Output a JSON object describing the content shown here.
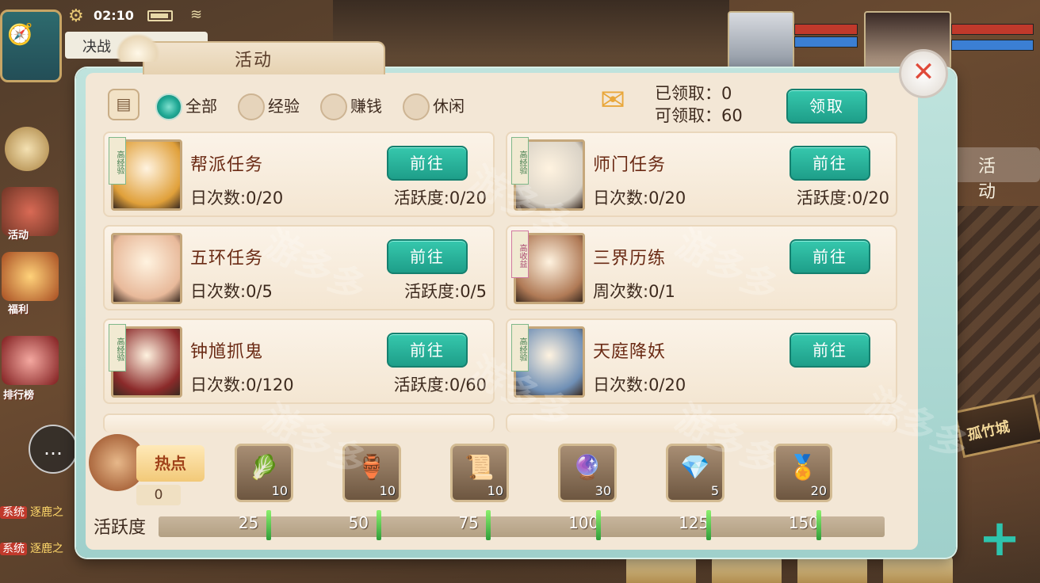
{
  "status": {
    "time": "02:10"
  },
  "hud": {
    "duel_tab": "决战",
    "right_tab": "活动",
    "city_sign": "孤竹城",
    "side_items": [
      "活动",
      "福利",
      "排行榜"
    ],
    "chat_lines": [
      {
        "tag": "系统",
        "text": "逐鹿之"
      },
      {
        "tag": "系统",
        "text": "逐鹿之"
      }
    ]
  },
  "panel": {
    "title": "活动",
    "close_glyph": "✕",
    "filters": [
      {
        "label": "全部",
        "selected": true
      },
      {
        "label": "经验",
        "selected": false
      },
      {
        "label": "赚钱",
        "selected": false
      },
      {
        "label": "休闲",
        "selected": false
      }
    ],
    "claimed_label": "已领取：0",
    "claimable_label": "可领取：60",
    "claim_button": "领取",
    "cards": [
      {
        "name": "帮派任务",
        "count": "日次数:0/20",
        "active": "活跃度:0/20",
        "button": "前往",
        "tag": "高经验",
        "tag_color": "green",
        "avatar_color": "#e0a03a"
      },
      {
        "name": "师门任务",
        "count": "日次数:0/20",
        "active": "活跃度:0/20",
        "button": "前往",
        "tag": "高经验",
        "tag_color": "green",
        "avatar_color": "#d9d2c6"
      },
      {
        "name": "五环任务",
        "count": "日次数:0/5",
        "active": "活跃度:0/5",
        "button": "前往",
        "tag": "",
        "tag_color": "",
        "avatar_color": "#e8b99a"
      },
      {
        "name": "三界历练",
        "count": "周次数:0/1",
        "active": "",
        "button": "前往",
        "tag": "高收益",
        "tag_color": "pink",
        "avatar_color": "#b07a56"
      },
      {
        "name": "钟馗抓鬼",
        "count": "日次数:0/120",
        "active": "活跃度:0/60",
        "button": "前往",
        "tag": "高经验",
        "tag_color": "green",
        "avatar_color": "#8b2a2a"
      },
      {
        "name": "天庭降妖",
        "count": "日次数:0/20",
        "active": "",
        "button": "前往",
        "tag": "高经验",
        "tag_color": "green",
        "avatar_color": "#6f8fb5"
      }
    ],
    "hot": {
      "label": "热点",
      "count": "0"
    },
    "rewards": [
      {
        "icon": "cabbage-icon",
        "glyph": "🥬",
        "qty": "10"
      },
      {
        "icon": "vase-icon",
        "glyph": "🏺",
        "qty": "10"
      },
      {
        "icon": "scroll-icon",
        "glyph": "📜",
        "qty": "10"
      },
      {
        "icon": "crystal-ball-icon",
        "glyph": "🔮",
        "qty": "30"
      },
      {
        "icon": "gem-icon",
        "glyph": "💎",
        "qty": "5"
      },
      {
        "icon": "medal-icon",
        "glyph": "🏅",
        "qty": "20"
      }
    ],
    "activity": {
      "label": "活跃度",
      "current": 0,
      "max": 165,
      "milestones": [
        "25",
        "50",
        "75",
        "100",
        "125",
        "150"
      ]
    }
  },
  "watermark": "游多多"
}
